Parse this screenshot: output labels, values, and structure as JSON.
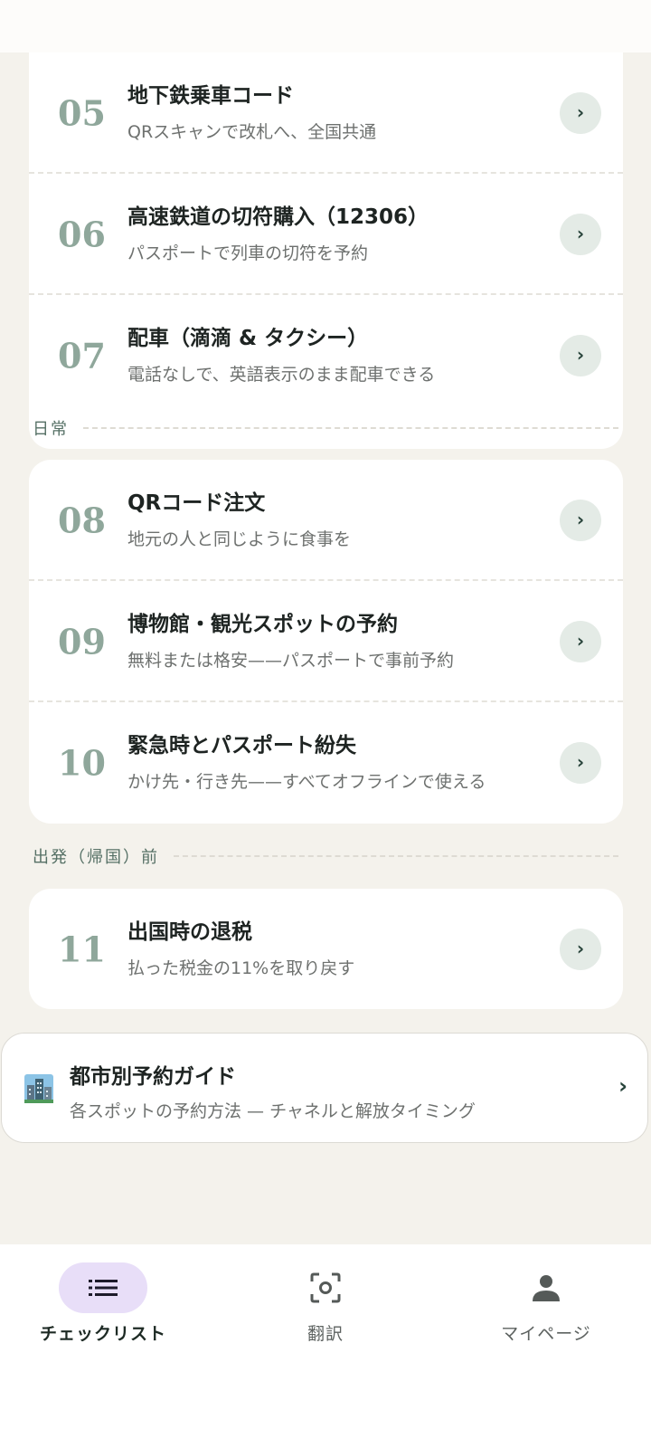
{
  "sections": [
    {
      "label": "",
      "items": [
        {
          "num": "05",
          "title": "地下鉄乗車コード",
          "sub": "QRスキャンで改札へ、全国共通"
        },
        {
          "num": "06",
          "title": "高速鉄道の切符購入（12306）",
          "sub": "パスポートで列車の切符を予約"
        },
        {
          "num": "07",
          "title": "配車（滴滴 & タクシー）",
          "sub": "電話なしで、英語表示のまま配車できる"
        }
      ]
    },
    {
      "label": "日常",
      "items": [
        {
          "num": "08",
          "title": "QRコード注文",
          "sub": "地元の人と同じように食事を"
        },
        {
          "num": "09",
          "title": "博物館・観光スポットの予約",
          "sub": "無料または格安——パスポートで事前予約"
        },
        {
          "num": "10",
          "title": "緊急時とパスポート紛失",
          "sub": "かけ先・行き先——すべてオフラインで使える"
        }
      ]
    },
    {
      "label": "出発（帰国）前",
      "items": [
        {
          "num": "11",
          "title": "出国時の退税",
          "sub": "払った税金の11%を取り戻す"
        }
      ]
    }
  ],
  "chevron": "›",
  "guide": {
    "icon": "city-icon",
    "title": "都市別予約ガイド",
    "sub": "各スポットの予約方法 — チャネルと解放タイミング"
  },
  "nav": {
    "checklist": "チェックリスト",
    "translate": "翻訳",
    "mypage": "マイページ"
  },
  "icons": {
    "nav_checklist": "list-icon",
    "nav_translate": "scan-icon",
    "nav_mypage": "person-icon"
  },
  "colors": {
    "background": "#f4f2ec",
    "card": "#ffffff",
    "number": "#8fa79b",
    "chevron_bg": "#e4ebe6",
    "nav_active_pill": "#e8def8"
  }
}
